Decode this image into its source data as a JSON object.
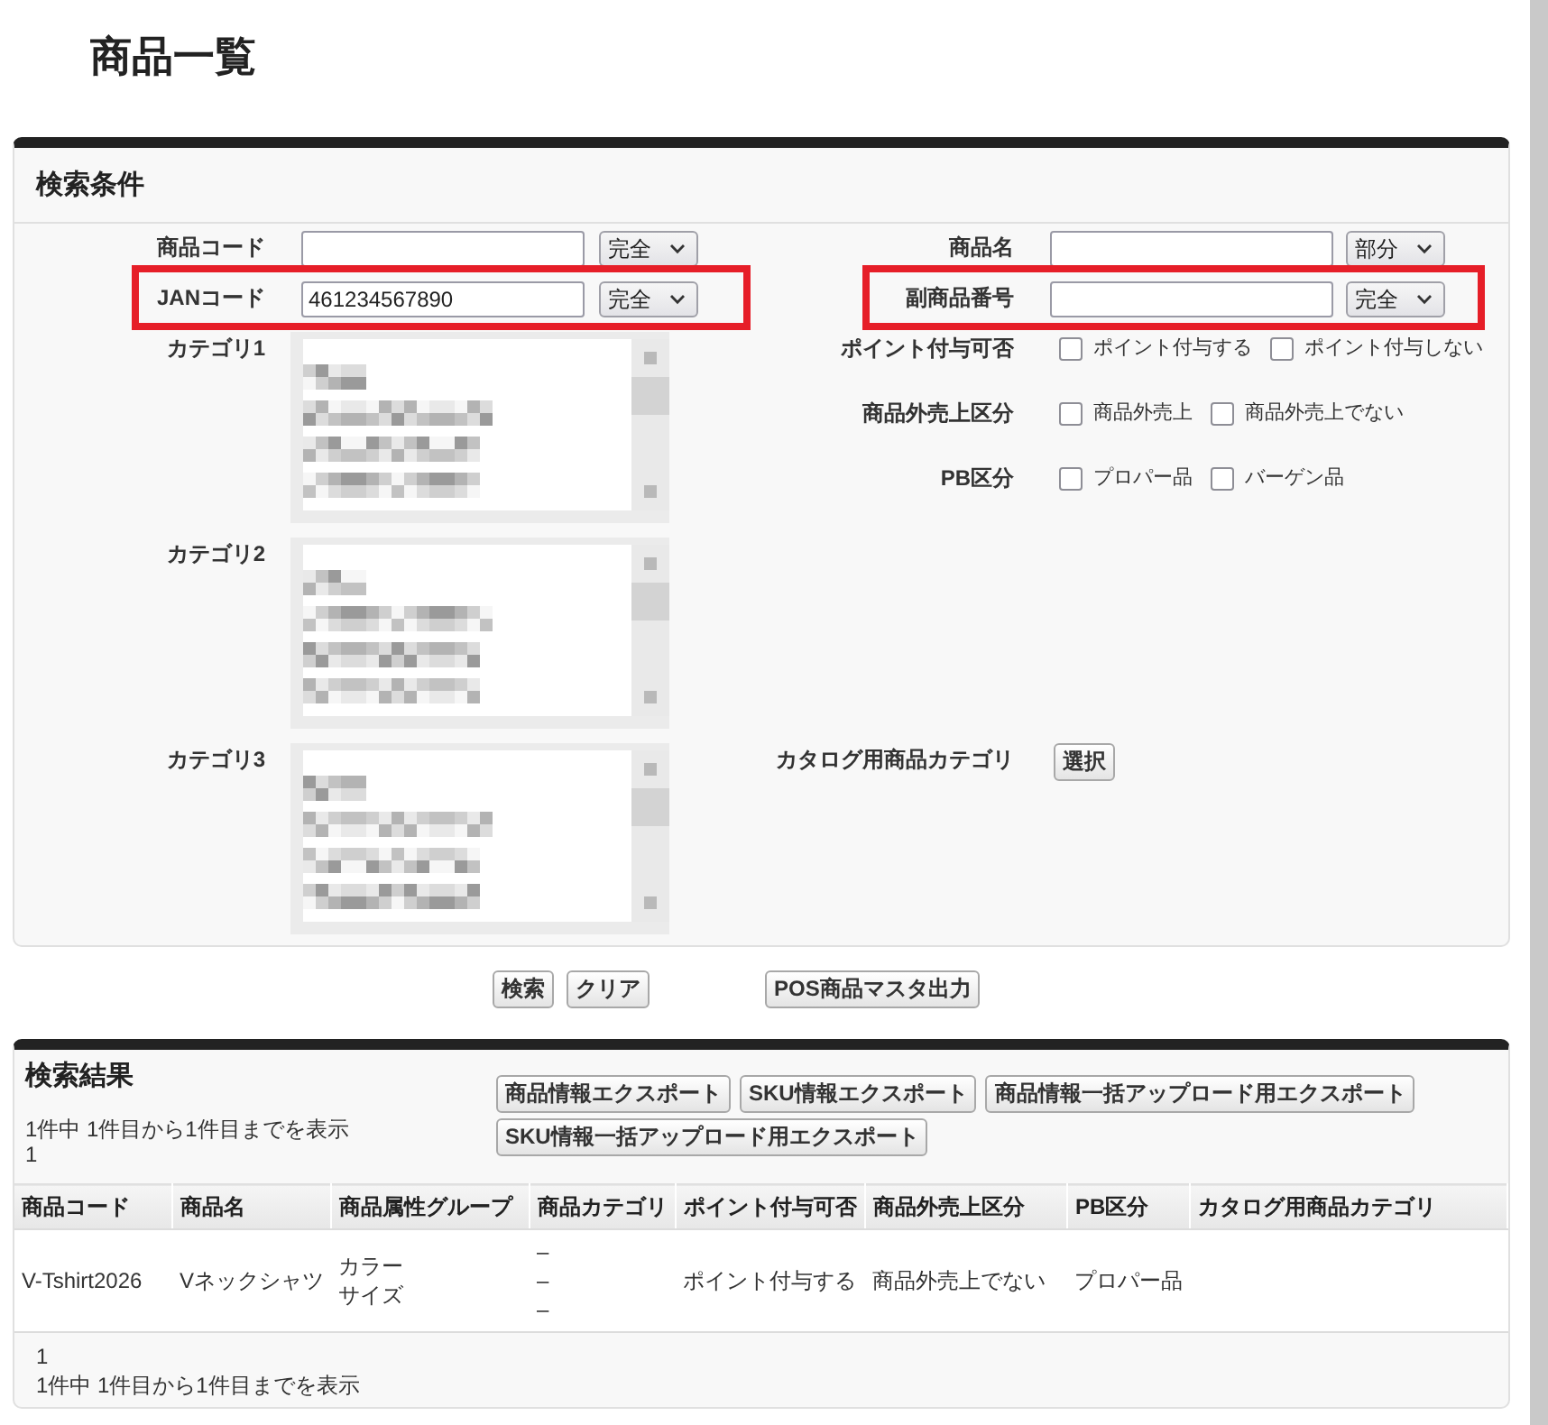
{
  "page_title": "商品一覧",
  "search_panel": {
    "title": "検索条件",
    "rows": [
      {
        "left": [
          {
            "kind": "text",
            "label": "商品コード",
            "match": "完全",
            "highlighted": false
          }
        ],
        "right": [
          {
            "kind": "text",
            "label": "商品名",
            "match": "部分",
            "highlighted": false
          }
        ]
      },
      {
        "left": [
          {
            "kind": "text",
            "label": "JANコード",
            "value": "461234567890",
            "match": "完全",
            "highlighted": true
          }
        ],
        "right": [
          {
            "kind": "text",
            "label": "副商品番号",
            "match": "完全",
            "highlighted": true
          }
        ]
      },
      {
        "left": [
          {
            "kind": "listbox",
            "label": "カテゴリ1",
            "highlighted": false
          }
        ],
        "right": [
          {
            "kind": "checkboxes",
            "label": "ポイント付与可否",
            "highlighted": false,
            "options": [
              {
                "label": "ポイント付与する",
                "checked": false
              },
              {
                "label": "ポイント付与しない",
                "checked": false
              }
            ]
          },
          {
            "kind": "checkboxes",
            "label": "商品外売上区分",
            "highlighted": false,
            "options": [
              {
                "label": "商品外売上",
                "checked": false
              },
              {
                "label": "商品外売上でない",
                "checked": false
              }
            ]
          },
          {
            "kind": "checkboxes",
            "label": "PB区分",
            "highlighted": false,
            "options": [
              {
                "label": "プロパー品",
                "checked": false
              },
              {
                "label": "バーゲン品",
                "checked": false
              }
            ]
          }
        ]
      },
      {
        "left": [
          {
            "kind": "listbox",
            "label": "カテゴリ2",
            "highlighted": false
          }
        ]
      },
      {
        "left": [
          {
            "kind": "listbox",
            "label": "カテゴリ3",
            "highlighted": false
          }
        ],
        "right": [
          {
            "kind": "picker",
            "label": "カタログ用商品カテゴリ",
            "button": "選択",
            "highlighted": false
          }
        ]
      }
    ]
  },
  "actions": {
    "search": [
      "検索",
      "クリア"
    ],
    "export": [
      "POS商品マスタ出力"
    ]
  },
  "results_panel": {
    "title": "検索結果",
    "summary": "1件中 1件目から1件目までを表示",
    "page": "1",
    "export_buttons": [
      "商品情報エクスポート",
      "SKU情報エクスポート",
      "商品情報一括アップロード用エクスポート",
      "SKU情報一括アップロード用エクスポート"
    ],
    "table": {
      "columns": [
        "商品コード",
        "商品名",
        "商品属性グループ",
        "商品カテゴリ",
        "ポイント付与可否",
        "商品外売上区分",
        "PB区分",
        "カタログ用商品カテゴリ"
      ],
      "rows": [
        {
          "cells": [
            [
              "V-Tshirt2026"
            ],
            [
              "Vネックシャツ"
            ],
            [
              "カラー",
              "サイズ"
            ],
            [
              "–",
              "–",
              "–"
            ],
            [
              "ポイント付与する"
            ],
            [
              "商品外売上でない"
            ],
            [
              "プロパー品"
            ]
          ]
        }
      ]
    },
    "footer": {
      "page": "1",
      "summary": "1件中 1件目から1件目までを表示"
    }
  }
}
